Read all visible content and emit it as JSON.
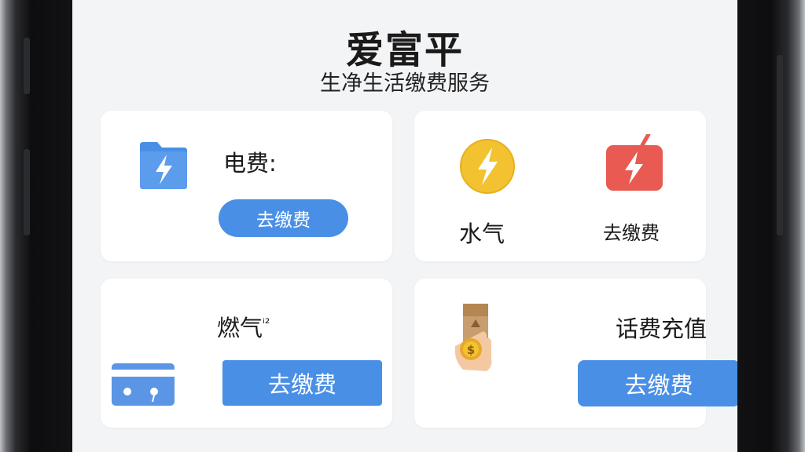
{
  "header": {
    "title": "爱富平",
    "subtitle": "生净生活缴费服务"
  },
  "cards": {
    "electricity": {
      "label": "电费:",
      "button": "去缴费",
      "icon": "lightning-folder-icon"
    },
    "water_gas": {
      "label": "水气",
      "action": "去缴费",
      "icons": [
        "lightning-circle-icon",
        "lightning-card-icon"
      ]
    },
    "gas": {
      "label": "燃气",
      "label_mark": "ⁱ²",
      "button": "去缴费",
      "icon": "gas-card-icon"
    },
    "phone": {
      "label": "话费充值",
      "button": "去缴费",
      "icon": "coin-hand-icon"
    }
  },
  "colors": {
    "accent": "#4a8fe6",
    "folder_blue": "#4a8fe6",
    "circle_yellow": "#f2c230",
    "card_red": "#e85a52"
  }
}
